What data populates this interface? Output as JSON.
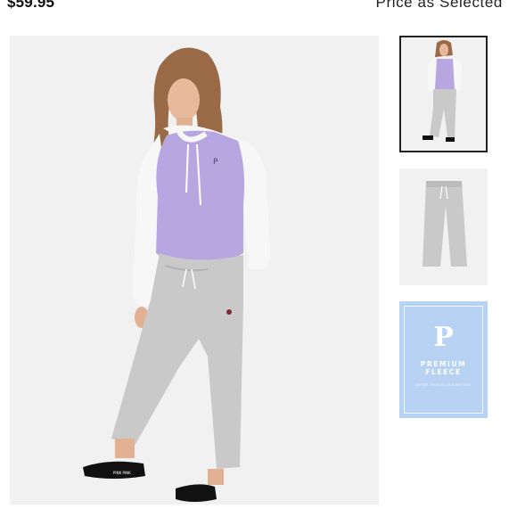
{
  "product": {
    "price": "$59.95",
    "price_note": "Price as Selected"
  },
  "gallery": {
    "thumbnails": [
      {
        "label": "Hoodie and pants outfit",
        "selected": true
      },
      {
        "label": "Cropped fleece pants",
        "selected": false
      },
      {
        "label": "Premium fleece badge",
        "selected": false
      }
    ],
    "badge": {
      "logo": "P",
      "title": "PREMIUM\nFLEECE",
      "subtitle": "SOFTER, THICKER & OUR BEST FEEL"
    }
  },
  "colors": {
    "hoodie_lavender": "#b8a6e0",
    "hoodie_white": "#f7f7f7",
    "pants_gray": "#c9c9c9",
    "badge_blue": "#b7d2f2",
    "background": "#f2f2f2"
  }
}
